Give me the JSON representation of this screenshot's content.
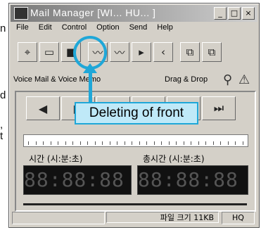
{
  "outside_text": {
    "left_top": "n",
    "left_mid": "d",
    "left_comma": ",",
    "left_bottom": "t"
  },
  "window": {
    "title": "Mail Manager [WI... HU... ]",
    "min": "_",
    "max": "□",
    "close": "×"
  },
  "menu": [
    "File",
    "Edit",
    "Control",
    "Option",
    "Send",
    "Help"
  ],
  "toolbar_icons": [
    "⌖",
    "▭",
    "■",
    "〰",
    "〰",
    "▸",
    "‹",
    "⧉",
    "⧉"
  ],
  "infobar": {
    "left": "Voice Mail & Voice Memo",
    "right": "Drag & Drop",
    "icon1": "⚲",
    "icon2": "⚠"
  },
  "controls": [
    "◀",
    "▶",
    "■",
    "●",
    "⏏",
    "⏭"
  ],
  "labels": {
    "time": "시간 (시:분:초)",
    "total_time": "총시간 (시:분:초)"
  },
  "lcd": {
    "left": "88:88:88",
    "right": "88:88:88"
  },
  "status": {
    "file_size": "파일 크기 11KB",
    "mode": "HQ"
  },
  "callout": {
    "text": "Deleting of front",
    "color": "#1fa7d8"
  }
}
